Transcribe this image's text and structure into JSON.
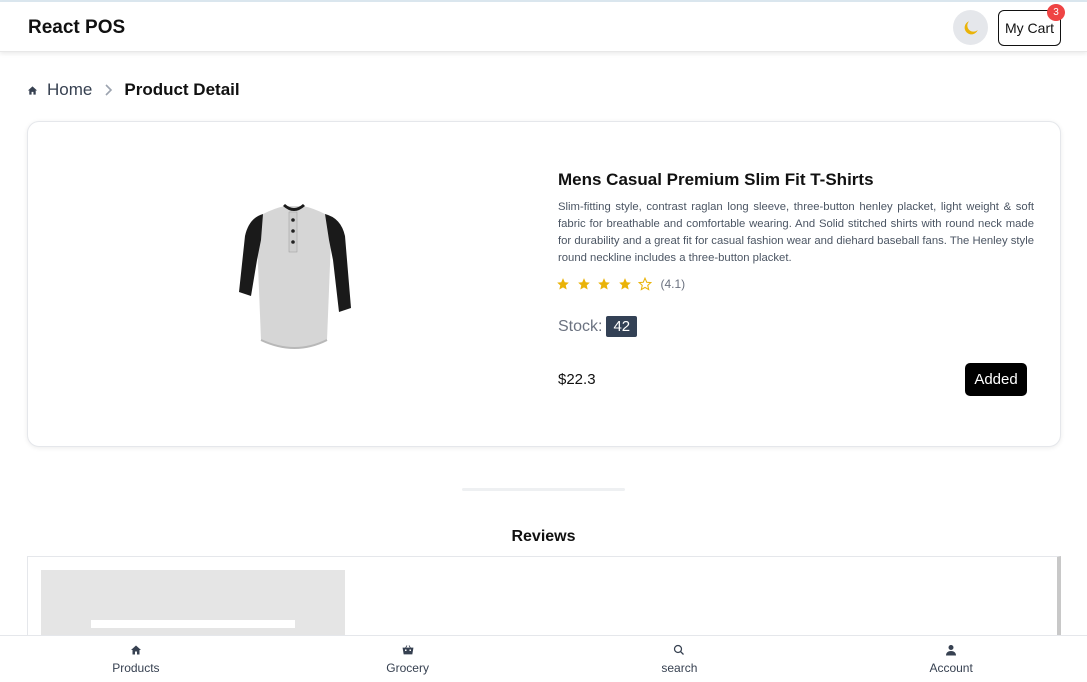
{
  "header": {
    "brand": "React POS",
    "theme_toggle_icon": "moon-icon",
    "cart_label": "My Cart",
    "cart_count": "3"
  },
  "breadcrumb": {
    "home_label": "Home",
    "current_label": "Product Detail"
  },
  "product": {
    "title": "Mens Casual Premium Slim Fit T-Shirts",
    "description": "Slim-fitting style, contrast raglan long sleeve, three-button henley placket, light weight & soft fabric for breathable and comfortable wearing. And Solid stitched shirts with round neck made for durability and a great fit for casual fashion wear and diehard baseball fans. The Henley style round neckline includes a three-button placket.",
    "rating": 4.1,
    "rating_text": "(4.1)",
    "stars": [
      {
        "state": "filled"
      },
      {
        "state": "filled"
      },
      {
        "state": "filled"
      },
      {
        "state": "filled"
      },
      {
        "state": "empty"
      }
    ],
    "stock_label": "Stock:",
    "stock_value": "42",
    "price": "$22.3",
    "button_label": "Added"
  },
  "reviews": {
    "title": "Reviews"
  },
  "bottom_nav": {
    "items": [
      {
        "label": "Products",
        "icon": "home-icon"
      },
      {
        "label": "Grocery",
        "icon": "basket-icon"
      },
      {
        "label": "search",
        "icon": "search-icon"
      },
      {
        "label": "Account",
        "icon": "user-icon"
      }
    ]
  },
  "colors": {
    "star": "#eab308",
    "moon": "#eab308",
    "badge": "#ef4444",
    "stock_badge": "#334155"
  }
}
